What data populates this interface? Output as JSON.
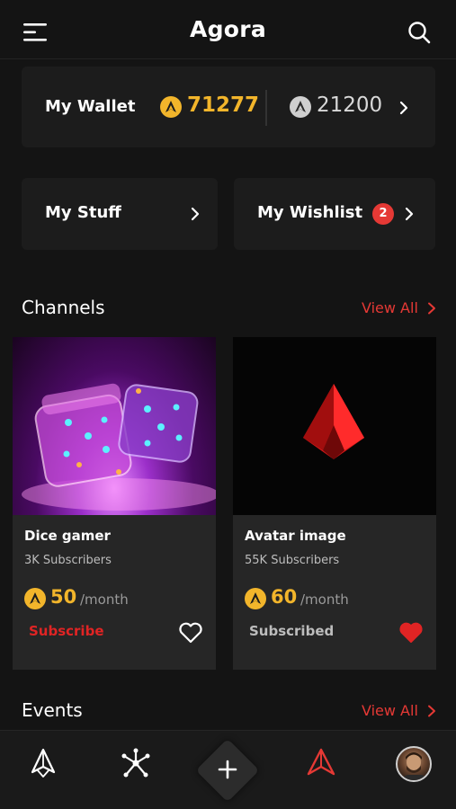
{
  "header": {
    "title": "Agora",
    "icons": [
      "menu-icon",
      "search-icon"
    ]
  },
  "wallet": {
    "label": "My Wallet",
    "gold_balance": "71277",
    "silver_balance": "21200"
  },
  "stuff": {
    "label": "My Stuff"
  },
  "wishlist": {
    "label": "My Wishlist",
    "badge_count": "2"
  },
  "channels": {
    "title": "Channels",
    "view_all": "View All",
    "items": [
      {
        "name": "Dice gamer",
        "subscribers": "3K Subscribers",
        "price": "50",
        "unit": "/month",
        "action": "Subscribe",
        "favorited": false
      },
      {
        "name": "Avatar image",
        "subscribers": "55K Subscribers",
        "price": "60",
        "unit": "/month",
        "action": "Subscribed",
        "favorited": true
      }
    ]
  },
  "events": {
    "title": "Events",
    "view_all": "View All"
  },
  "nav": {
    "items": [
      "home-logo-icon",
      "network-icon",
      "plus-icon",
      "agora-logo-icon",
      "avatar"
    ],
    "active": "agora-logo-icon"
  },
  "colors": {
    "accent": "#e53935",
    "gold": "#f2b52b",
    "background": "#141414",
    "card": "#1c1c1c"
  }
}
